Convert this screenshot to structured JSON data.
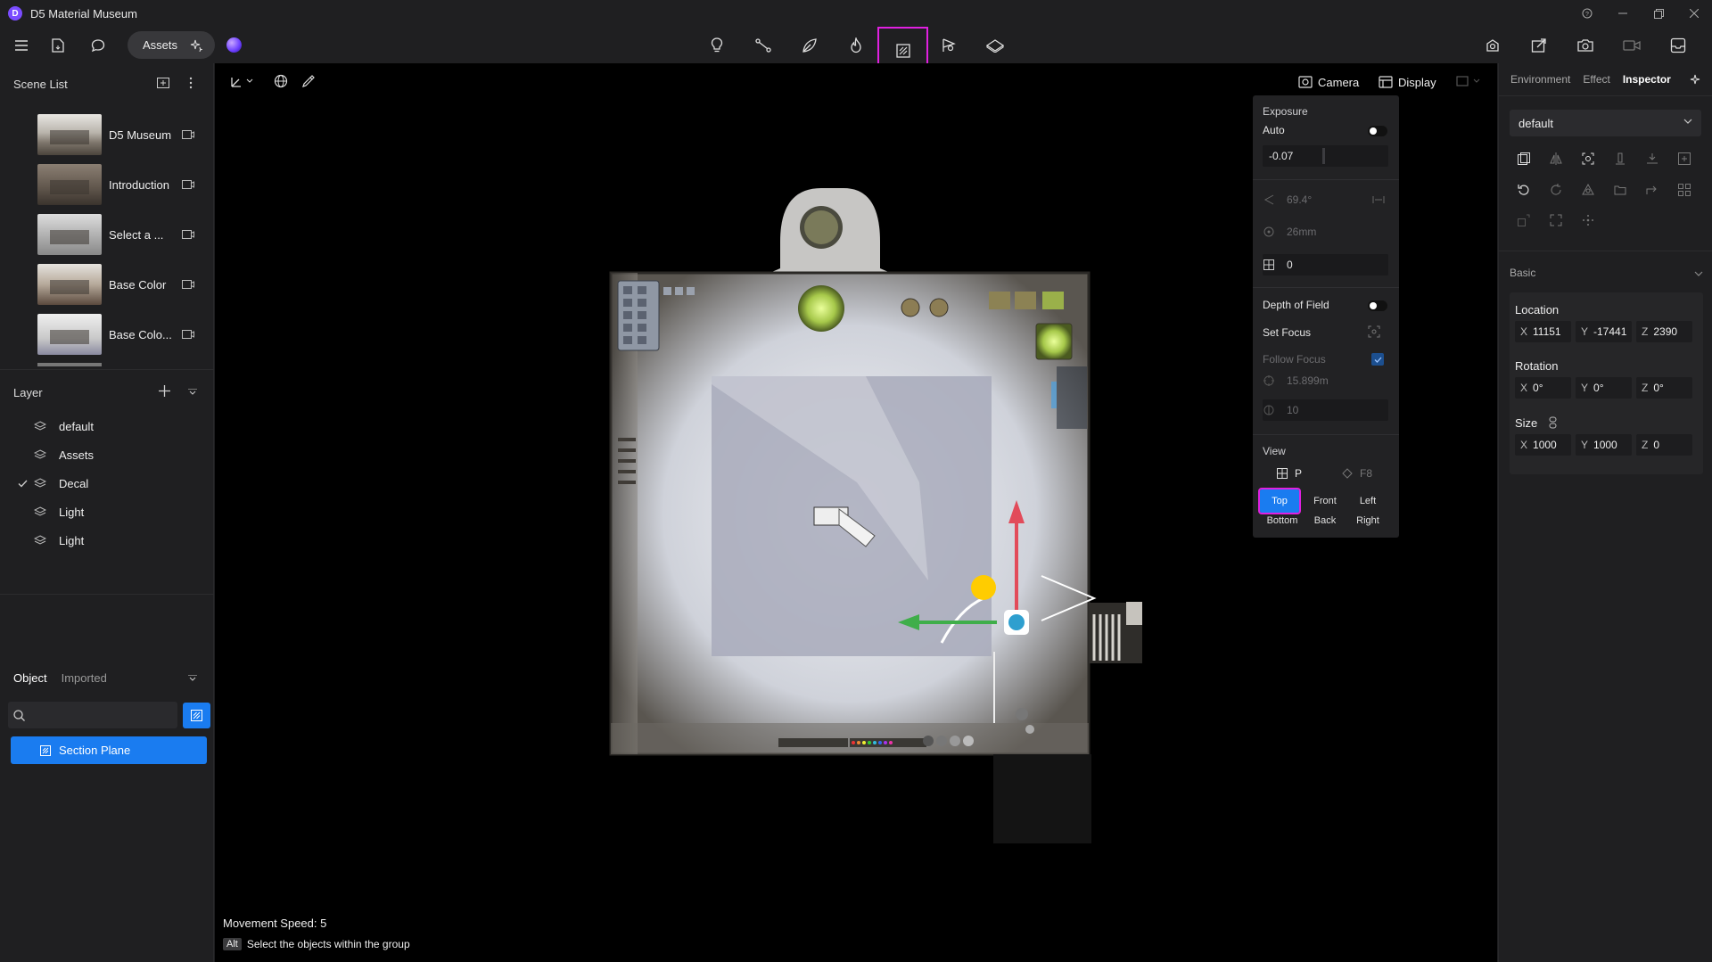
{
  "window": {
    "title": "D5 Material Museum",
    "logo_letter": "D"
  },
  "toolbar": {
    "assets_label": "Assets",
    "center_tools": [
      "light-bulb-icon",
      "path-icon",
      "leaf-icon",
      "fire-icon",
      "section-plane-icon",
      "marker-icon",
      "terrain-icon"
    ],
    "highlighted_tool": "section-plane-icon",
    "right_tools": [
      "render-icon",
      "export-icon",
      "camera-icon",
      "video-icon",
      "inbox-icon"
    ]
  },
  "scene_list": {
    "title": "Scene List",
    "items": [
      {
        "label": "D5 Museum"
      },
      {
        "label": "Introduction"
      },
      {
        "label": "Select a ..."
      },
      {
        "label": "Base Color"
      },
      {
        "label": "Base Colo..."
      }
    ]
  },
  "layer": {
    "title": "Layer",
    "items": [
      {
        "label": "default",
        "checked": false
      },
      {
        "label": "Assets",
        "checked": false
      },
      {
        "label": "Decal",
        "checked": true
      },
      {
        "label": "Light",
        "checked": false
      },
      {
        "label": "Light",
        "checked": false
      }
    ]
  },
  "objects": {
    "tab_object": "Object",
    "tab_imported": "Imported",
    "search_placeholder": "",
    "items": [
      {
        "label": "Section Plane"
      }
    ]
  },
  "viewport": {
    "camera_label": "Camera",
    "display_label": "Display",
    "movement_speed": "Movement Speed: 5",
    "alt_key": "Alt",
    "alt_hint": "Select the objects within the group"
  },
  "camera_panel": {
    "exposure_label": "Exposure",
    "auto_label": "Auto",
    "exposure_value": "-0.07",
    "fov_value": "69.4°",
    "focal_value": "26mm",
    "param_value": "0",
    "dof_label": "Depth of Field",
    "set_focus_label": "Set Focus",
    "follow_focus_label": "Follow Focus",
    "focus_distance": "15.899m",
    "aperture_value": "10",
    "view_label": "View",
    "perspective_label": "P",
    "f8_label": "F8",
    "views": [
      "Top",
      "Front",
      "Left",
      "Bottom",
      "Back",
      "Right"
    ],
    "active_view": "Top"
  },
  "inspector": {
    "tabs": [
      "Environment",
      "Effect",
      "Inspector"
    ],
    "active_tab": "Inspector",
    "preset": "default",
    "basic_label": "Basic",
    "location_label": "Location",
    "location": {
      "x": "11151",
      "y": "-17441",
      "z": "2390"
    },
    "rotation_label": "Rotation",
    "rotation": {
      "x": "0°",
      "y": "0°",
      "z": "0°"
    },
    "size_label": "Size",
    "size": {
      "x": "1000",
      "y": "1000",
      "z": "0"
    }
  },
  "colors": {
    "accent": "#1a7cf0",
    "highlight": "#e020e0",
    "gizmo_y": "#e24b5a",
    "gizmo_x": "#3fae4a",
    "light": "#ffcc00"
  }
}
